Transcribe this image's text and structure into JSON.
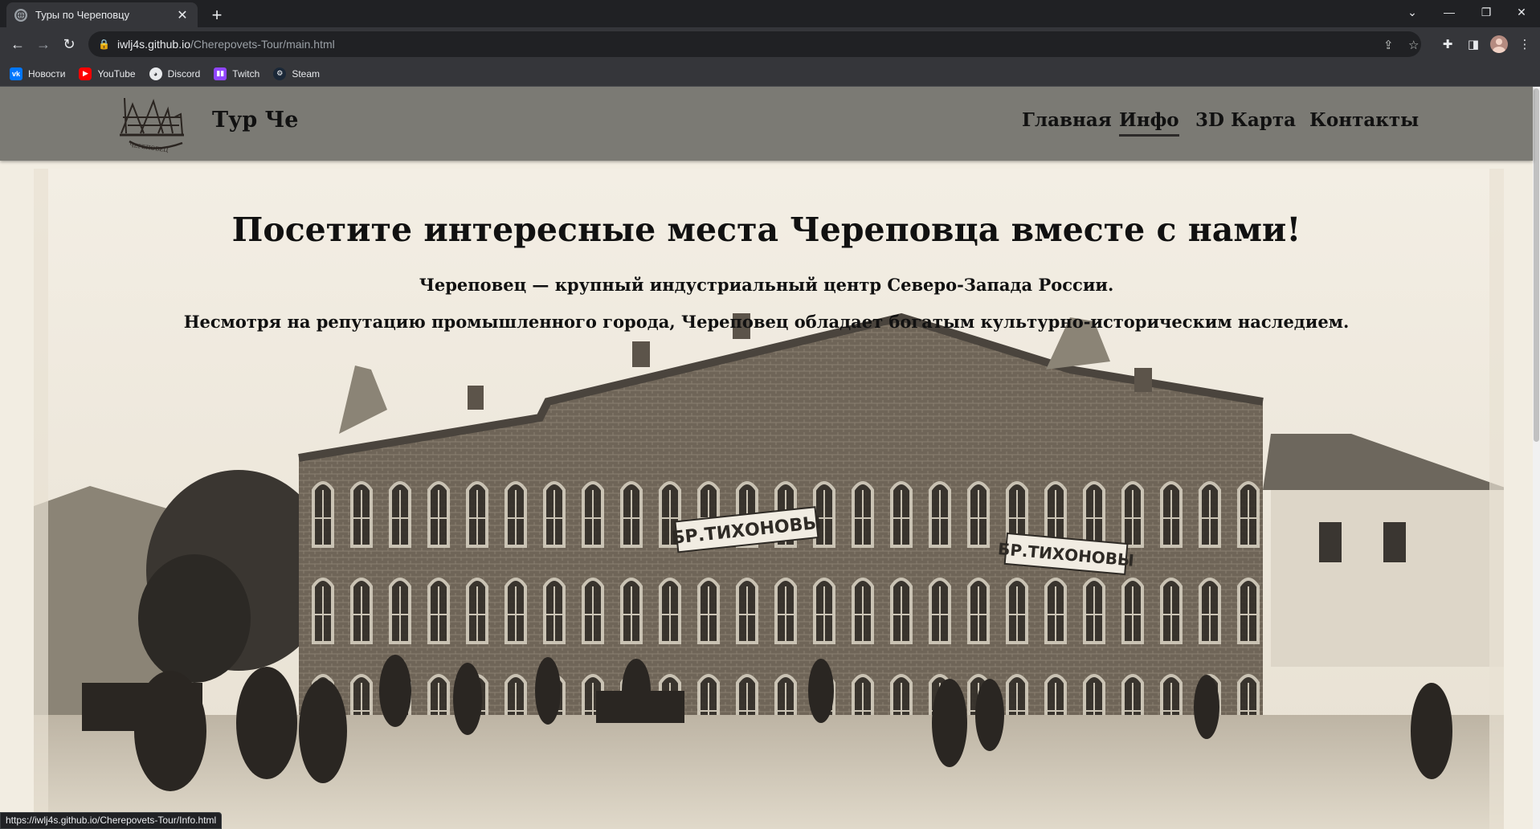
{
  "browser": {
    "tab": {
      "title": "Туры по Череповцу"
    },
    "address": {
      "host": "iwlj4s.github.io",
      "path": "/Cherepovets-Tour/main.html"
    },
    "bookmarks": [
      {
        "label": "Новости",
        "icon": "vk-icon",
        "color": "#0077ff"
      },
      {
        "label": "YouTube",
        "icon": "youtube-icon",
        "color": "#ff0000"
      },
      {
        "label": "Discord",
        "icon": "discord-icon",
        "color": "#e8eaed"
      },
      {
        "label": "Twitch",
        "icon": "twitch-icon",
        "color": "#9146ff"
      },
      {
        "label": "Steam",
        "icon": "steam-icon",
        "color": "#1b2838"
      }
    ],
    "status_url": "https://iwlj4s.github.io/Cherepovets-Tour/Info.html"
  },
  "site": {
    "brand": "Тур Че",
    "nav": [
      {
        "label": "Главная",
        "active": false
      },
      {
        "label": "Инфо",
        "active": true
      },
      {
        "label": "3D Карта",
        "active": false
      },
      {
        "label": "Контакты",
        "active": false
      }
    ],
    "hero": {
      "title": "Посетите интересные места Череповца вместе с нами!",
      "line1": "Череповец — крупный индустриальный центр Северо-Запада России.",
      "line2": "Несмотря на репутацию промышленного города, Череповец обладает богатым культурно-историческим наследием.",
      "sign": "БР.ТИХОНОВЫ"
    },
    "colors": {
      "header": "#7b7a74",
      "page": "#f2ede2",
      "text": "#111111"
    }
  }
}
